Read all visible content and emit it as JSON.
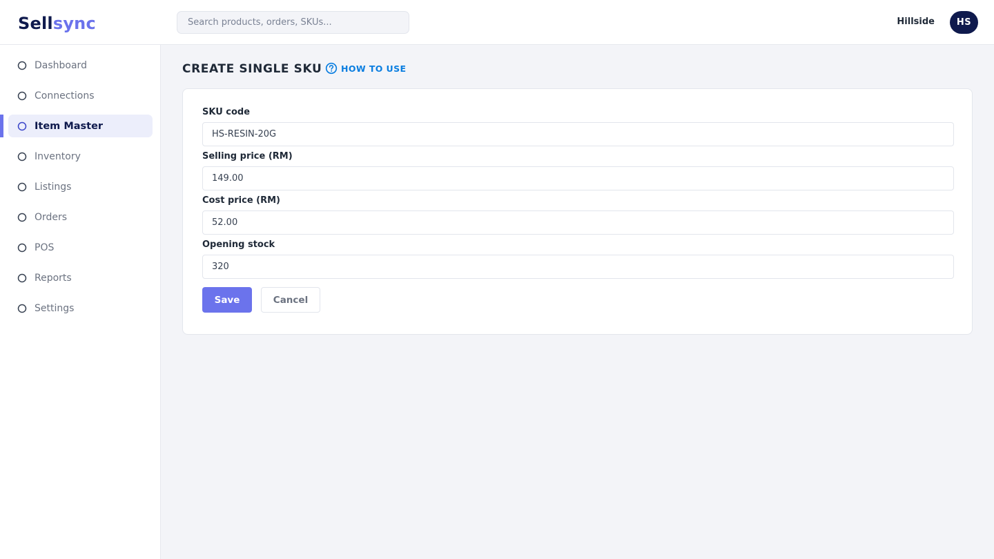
{
  "app": {
    "logo_part1": "Sell",
    "logo_part2": "sync",
    "brand_color": "#0f1a4d",
    "accent_color": "#6b73ec"
  },
  "header": {
    "search_placeholder": "Search products, orders, SKUs...",
    "store_name": "Hillside",
    "avatar_initials": "HS"
  },
  "sidebar": {
    "items": [
      {
        "label": "Dashboard",
        "icon": "circle-icon",
        "active": false
      },
      {
        "label": "Connections",
        "icon": "circle-icon",
        "active": false
      },
      {
        "label": "Item Master",
        "icon": "circle-icon",
        "active": true
      },
      {
        "label": "Inventory",
        "icon": "circle-icon",
        "active": false
      },
      {
        "label": "Listings",
        "icon": "circle-icon",
        "active": false
      },
      {
        "label": "Orders",
        "icon": "circle-icon",
        "active": false
      },
      {
        "label": "POS",
        "icon": "circle-icon",
        "active": false
      },
      {
        "label": "Reports",
        "icon": "circle-icon",
        "active": false
      },
      {
        "label": "Settings",
        "icon": "circle-icon",
        "active": false
      }
    ]
  },
  "main": {
    "title": "CREATE SINGLE SKU",
    "how_to_use": "HOW TO USE",
    "how_to_use_icon": "question-circle-icon",
    "form": {
      "sku_code": {
        "label": "SKU code",
        "value": "HS-RESIN-20G"
      },
      "selling_price": {
        "label": "Selling price (RM)",
        "value": "149.00"
      },
      "cost_price": {
        "label": "Cost price (RM)",
        "value": "52.00"
      },
      "opening_stock": {
        "label": "Opening stock",
        "value": "320"
      }
    },
    "save_label": "Save",
    "cancel_label": "Cancel"
  }
}
